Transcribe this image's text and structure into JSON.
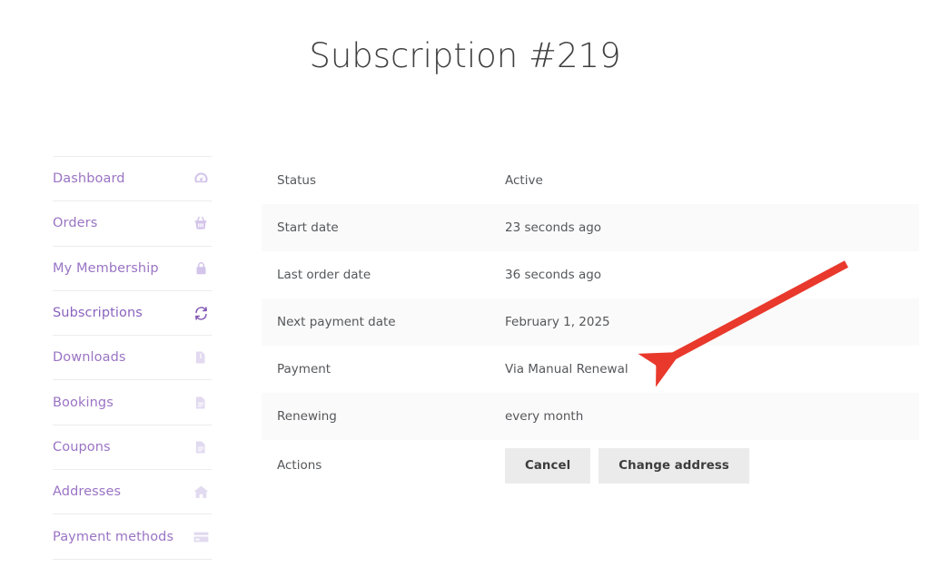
{
  "page": {
    "title": "Subscription #219"
  },
  "sidebar": {
    "items": [
      {
        "label": "Dashboard",
        "icon": "gauge-icon",
        "active": false
      },
      {
        "label": "Orders",
        "icon": "basket-icon",
        "active": false
      },
      {
        "label": "My Membership",
        "icon": "lock-icon",
        "active": false
      },
      {
        "label": "Subscriptions",
        "icon": "sync-icon",
        "active": true
      },
      {
        "label": "Downloads",
        "icon": "download-file-icon",
        "active": false
      },
      {
        "label": "Bookings",
        "icon": "document-icon",
        "active": false
      },
      {
        "label": "Coupons",
        "icon": "document-icon",
        "active": false
      },
      {
        "label": "Addresses",
        "icon": "home-icon",
        "active": false
      },
      {
        "label": "Payment methods",
        "icon": "credit-card-icon",
        "active": false
      }
    ]
  },
  "details": {
    "rows": [
      {
        "key": "Status",
        "value": "Active"
      },
      {
        "key": "Start date",
        "value": "23 seconds ago"
      },
      {
        "key": "Last order date",
        "value": "36 seconds ago"
      },
      {
        "key": "Next payment date",
        "value": "February 1, 2025"
      },
      {
        "key": "Payment",
        "value": "Via Manual Renewal"
      },
      {
        "key": "Renewing",
        "value": "every month"
      }
    ],
    "actions_label": "Actions",
    "actions": [
      {
        "label": "Cancel"
      },
      {
        "label": "Change address"
      }
    ]
  },
  "annotation": {
    "arrow_color": "#e8392c",
    "points_at": "Via Manual Renewal"
  },
  "colors": {
    "accent_purple": "#7f54b3",
    "link_purple": "#9a74c4",
    "stripe": "#fafafa",
    "button_bg": "#ebebeb",
    "arrow_red": "#e8392c"
  }
}
